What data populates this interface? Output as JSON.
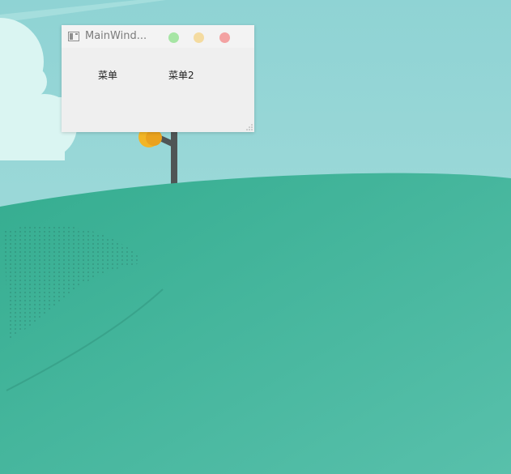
{
  "window": {
    "title": "MainWind...",
    "menus": [
      {
        "label": "菜单"
      },
      {
        "label": "菜单2"
      }
    ]
  },
  "colors": {
    "sky": "#9fdadb",
    "hill": "#3fb49a",
    "cloud": "#daf5f2",
    "window_bg": "#efefef",
    "minimize": "#a6e5a4",
    "maximize": "#f4dba0",
    "close": "#f3a2a2"
  },
  "icons": {
    "app": "window-icon",
    "minimize": "minimize-icon",
    "maximize": "maximize-icon",
    "close": "close-icon",
    "resize": "resize-grip-icon"
  }
}
